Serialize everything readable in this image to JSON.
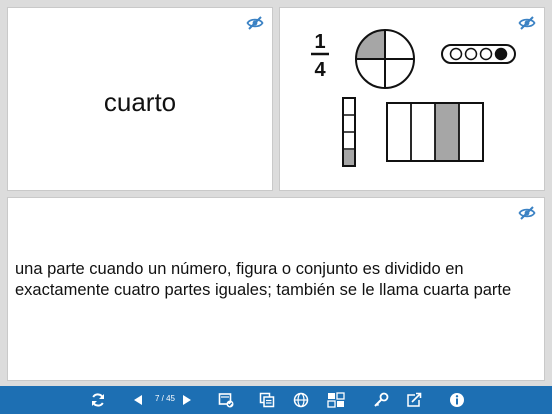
{
  "word_card": {
    "term": "cuarto",
    "hide_icon": "eye-slash-icon"
  },
  "visual_card": {
    "fraction_numerator": "1",
    "fraction_denominator": "4",
    "hide_icon": "eye-slash-icon",
    "pie_shaded_parts": 1,
    "pie_total_parts": 4,
    "beads_shaded": 1,
    "beads_total": 4,
    "vertical_bar_shaded": 1,
    "vertical_bar_total": 4,
    "rectangle_shaded_index": 3,
    "rectangle_total_parts": 4
  },
  "definition_card": {
    "text": "una parte cuando un número, figura o conjunto es dividido en exactamente cuatro partes iguales; también se le llama cuarta parte",
    "hide_icon": "eye-slash-icon"
  },
  "toolbar": {
    "page_counter": "7 / 45",
    "icons": [
      "refresh-icon",
      "prev-icon",
      "next-icon",
      "cards-check-icon",
      "copy-icon",
      "globe-icon",
      "grid-icon",
      "key-icon",
      "share-icon",
      "info-icon"
    ]
  },
  "colors": {
    "accent": "#1d6fb3",
    "icon_blue": "#3b82c4",
    "shade_gray": "#a6a6a6"
  }
}
